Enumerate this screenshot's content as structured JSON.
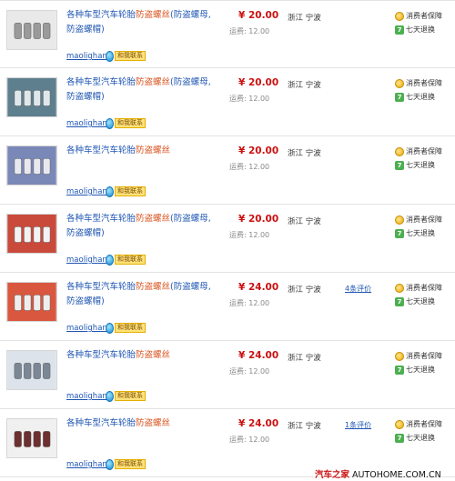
{
  "listings": [
    {
      "title_a": "各种车型汽车轮胎",
      "title_kw": "防盗螺丝",
      "title_b": "(防盗螺母,",
      "title_c": "防盗螺帽)",
      "seller": "maolighang",
      "contact": "和我联系",
      "price": "¥ 20.00",
      "shipping": "运费: 12.00",
      "location": "浙江  宁波",
      "reviews": "",
      "guarantee": "消费者保障",
      "returns": "七天退换",
      "thumb_bg": "#e9e9e9",
      "thumb_fg": "#9a9a9a"
    },
    {
      "title_a": "各种车型汽车轮胎",
      "title_kw": "防盗螺丝",
      "title_b": "(防盗螺母,",
      "title_c": "防盗螺帽)",
      "seller": "maolighang",
      "contact": "和我联系",
      "price": "¥ 20.00",
      "shipping": "运费: 12.00",
      "location": "浙江  宁波",
      "reviews": "",
      "guarantee": "消费者保障",
      "returns": "七天退换",
      "thumb_bg": "#5e7f8e",
      "thumb_fg": "#dfe7ea"
    },
    {
      "title_a": "各种车型汽车轮胎",
      "title_kw": "防盗螺丝",
      "title_b": "",
      "title_c": "",
      "seller": "maolighang",
      "contact": "和我联系",
      "price": "¥ 20.00",
      "shipping": "运费: 12.00",
      "location": "浙江  宁波",
      "reviews": "",
      "guarantee": "消费者保障",
      "returns": "七天退换",
      "thumb_bg": "#7a88b8",
      "thumb_fg": "#e8e8ee"
    },
    {
      "title_a": "各种车型汽车轮胎",
      "title_kw": "防盗螺丝",
      "title_b": "(防盗螺母,",
      "title_c": "防盗螺帽)",
      "seller": "maolighang",
      "contact": "和我联系",
      "price": "¥ 20.00",
      "shipping": "运费: 12.00",
      "location": "浙江  宁波",
      "reviews": "",
      "guarantee": "消费者保障",
      "returns": "七天退换",
      "thumb_bg": "#c94a3b",
      "thumb_fg": "#f2f2f2"
    },
    {
      "title_a": "各种车型汽车轮胎",
      "title_kw": "防盗螺丝",
      "title_b": "(防盗螺母,",
      "title_c": "防盗螺帽)",
      "seller": "maolighang",
      "contact": "和我联系",
      "price": "¥ 24.00",
      "shipping": "运费: 12.00",
      "location": "浙江  宁波",
      "reviews": "4条评价",
      "guarantee": "消费者保障",
      "returns": "七天退换",
      "thumb_bg": "#d9573f",
      "thumb_fg": "#eeeeee"
    },
    {
      "title_a": "各种车型汽车轮胎",
      "title_kw": "防盗螺丝",
      "title_b": "",
      "title_c": "",
      "seller": "maolighang",
      "contact": "和我联系",
      "price": "¥ 24.00",
      "shipping": "运费: 12.00",
      "location": "浙江  宁波",
      "reviews": "",
      "guarantee": "消费者保障",
      "returns": "七天退换",
      "thumb_bg": "#dde3ea",
      "thumb_fg": "#7c8796"
    },
    {
      "title_a": "各种车型汽车轮胎",
      "title_kw": "防盗螺丝",
      "title_b": "",
      "title_c": "",
      "seller": "maolighang",
      "contact": "和我联系",
      "price": "¥ 24.00",
      "shipping": "运费: 12.00",
      "location": "浙江  宁波",
      "reviews": "1条评价",
      "guarantee": "消费者保障",
      "returns": "七天退换",
      "thumb_bg": "#f0f0f0",
      "thumb_fg": "#6e2f2f"
    }
  ],
  "watermark": {
    "brand": "汽车之家",
    "domain": "AUTOHOME.COM.CN"
  }
}
